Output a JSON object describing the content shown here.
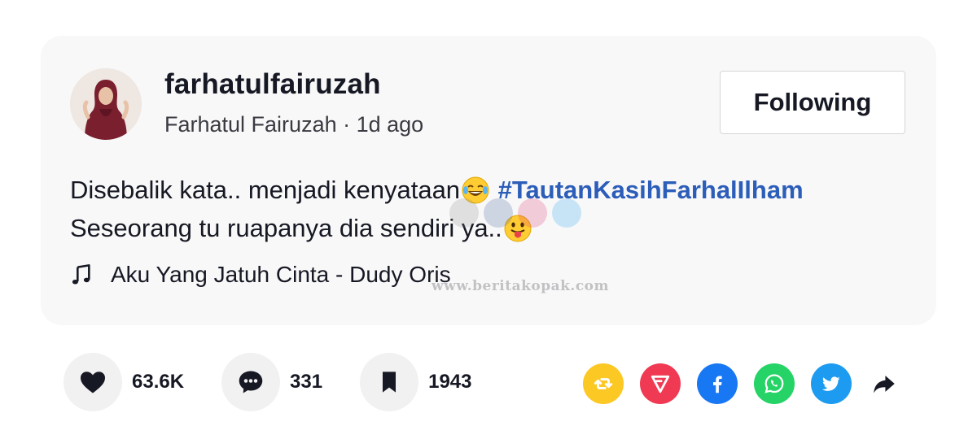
{
  "post": {
    "username": "farhatulfairuzah",
    "display_name": "Farhatul Fairuzah",
    "separator": " · ",
    "time_ago": "1d ago",
    "follow_label": "Following",
    "caption_line1_text": "Disebalik kata.. menjadi kenyataan",
    "caption_line1_emoji": "face-with-tears-of-joy",
    "hashtag": "#TautanKasihFarhalIlham",
    "caption_line2_text": "Seseorang tu ruapanya dia sendiri ya..",
    "caption_line2_emoji": "face-with-tongue",
    "music_icon": "music-note-icon",
    "music_title": "Aku Yang Jatuh Cinta - Dudy Oris",
    "watermark": "www.beritakopak.com"
  },
  "actions": {
    "like": {
      "icon": "heart-icon",
      "count": "63.6K"
    },
    "comment": {
      "icon": "comment-icon",
      "count": "331"
    },
    "save": {
      "icon": "bookmark-icon",
      "count": "1943"
    }
  },
  "share": [
    {
      "name": "repost",
      "icon": "repost-icon",
      "color": "#fcc824"
    },
    {
      "name": "send",
      "icon": "send-icon",
      "color": "#f03a53"
    },
    {
      "name": "facebook",
      "icon": "facebook-icon",
      "color": "#1877f2"
    },
    {
      "name": "whatsapp",
      "icon": "whatsapp-icon",
      "color": "#25d366"
    },
    {
      "name": "twitter",
      "icon": "twitter-icon",
      "color": "#1d9bf0"
    },
    {
      "name": "more",
      "icon": "share-arrow-icon",
      "color": "#161823"
    }
  ],
  "colors": {
    "card_bg": "#f8f8f8",
    "hashtag": "#2b5db9",
    "text": "#161823",
    "secondary_text": "#3a3b42"
  }
}
